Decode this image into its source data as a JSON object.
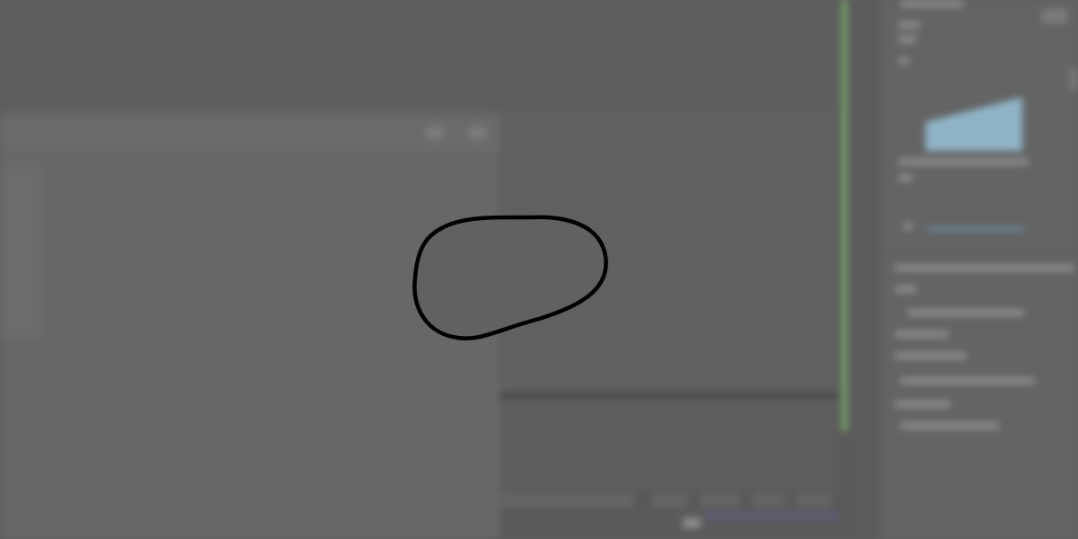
{
  "window": {
    "tab_label": "",
    "panel_title": ""
  },
  "theme": {
    "background": "#5f5f5f",
    "accent_green": "#79a76a",
    "accent_blue": "#8fb3c6",
    "progress_purple": "#5e5b76"
  },
  "overlay": {
    "shape": "freeform-lasso-outline",
    "stroke_color": "#000000",
    "fill_color": "#616161"
  }
}
